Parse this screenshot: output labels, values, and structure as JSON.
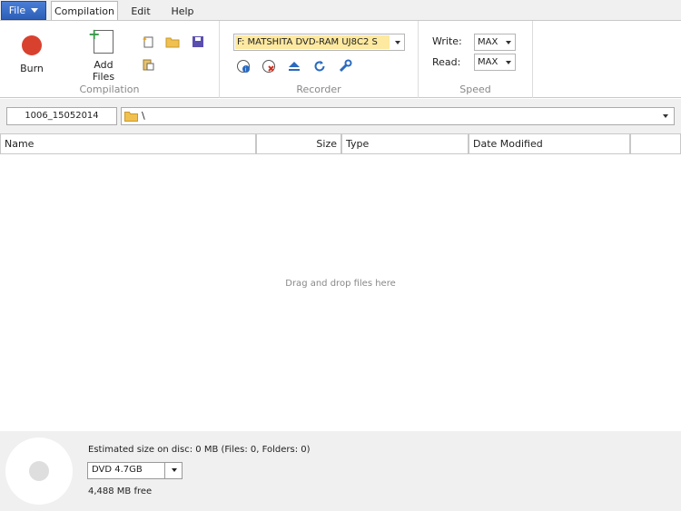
{
  "menu": {
    "file_label": "File",
    "tabs": [
      {
        "label": "Compilation",
        "active": true
      },
      {
        "label": "Edit",
        "active": false
      },
      {
        "label": "Help",
        "active": false
      }
    ]
  },
  "ribbon": {
    "compilation": {
      "group_label": "Compilation",
      "burn_label": "Burn",
      "add_files_label": "Add Files",
      "small_icons": [
        "new-compilation-icon",
        "open-folder-icon",
        "save-icon",
        "paste-icon"
      ]
    },
    "recorder": {
      "group_label": "Recorder",
      "drive_selected": "F: MATSHITA DVD-RAM UJ8C2 S",
      "icons": [
        "disc-info-icon",
        "erase-disc-icon",
        "eject-icon",
        "refresh-icon",
        "tools-icon"
      ]
    },
    "speed": {
      "group_label": "Speed",
      "write_label": "Write:",
      "write_value": "MAX",
      "read_label": "Read:",
      "read_value": "MAX"
    }
  },
  "pathbar": {
    "disc_label": "1006_15052014",
    "path": "\\"
  },
  "columns": [
    "Name",
    "Size",
    "Type",
    "Date Modified",
    ""
  ],
  "file_list": {
    "empty_hint": "Drag and drop files here"
  },
  "status": {
    "estimated": "Estimated size on disc: 0 MB (Files: 0, Folders: 0)",
    "disc_type": "DVD 4.7GB",
    "free": "4,488 MB free"
  },
  "colors": {
    "file_button": "#2d5fb8",
    "burn": "#d9412f",
    "drive_highlight": "#fde9a0"
  }
}
